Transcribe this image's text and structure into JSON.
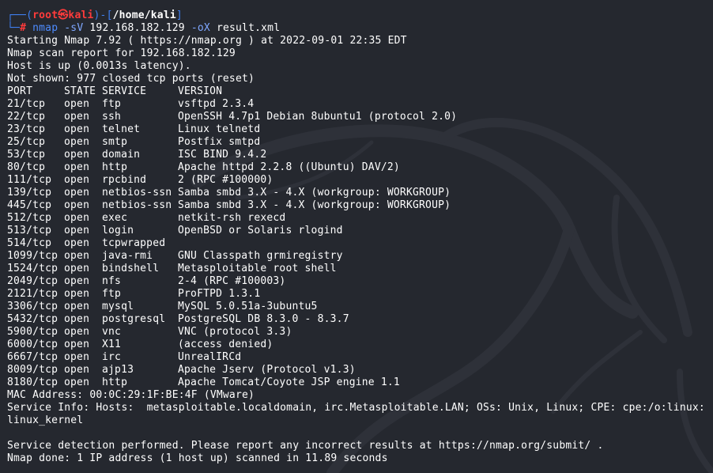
{
  "prompt": {
    "top_left": "┌──(",
    "user": "root",
    "at_symbol": "㉿",
    "host": "kali",
    "mid": ")-[",
    "path": "/home/kali",
    "close": "]",
    "bottom_left": "└─",
    "hash": "#",
    "command": "nmap",
    "flag1": "-sV",
    "target": "192.168.182.129",
    "flag2": "-oX",
    "outfile": "result.xml"
  },
  "output": {
    "start_line": "Starting Nmap 7.92 ( https://nmap.org ) at 2022-09-01 22:35 EDT",
    "report_line": "Nmap scan report for 192.168.182.129",
    "host_up": "Host is up (0.0013s latency).",
    "not_shown": "Not shown: 977 closed tcp ports (reset)",
    "headers": {
      "port": "PORT",
      "state": "STATE",
      "service": "SERVICE",
      "version": "VERSION"
    },
    "ports": [
      {
        "port": "21/tcp",
        "state": "open",
        "service": "ftp",
        "version": "vsftpd 2.3.4"
      },
      {
        "port": "22/tcp",
        "state": "open",
        "service": "ssh",
        "version": "OpenSSH 4.7p1 Debian 8ubuntu1 (protocol 2.0)"
      },
      {
        "port": "23/tcp",
        "state": "open",
        "service": "telnet",
        "version": "Linux telnetd"
      },
      {
        "port": "25/tcp",
        "state": "open",
        "service": "smtp",
        "version": "Postfix smtpd"
      },
      {
        "port": "53/tcp",
        "state": "open",
        "service": "domain",
        "version": "ISC BIND 9.4.2"
      },
      {
        "port": "80/tcp",
        "state": "open",
        "service": "http",
        "version": "Apache httpd 2.2.8 ((Ubuntu) DAV/2)"
      },
      {
        "port": "111/tcp",
        "state": "open",
        "service": "rpcbind",
        "version": "2 (RPC #100000)"
      },
      {
        "port": "139/tcp",
        "state": "open",
        "service": "netbios-ssn",
        "version": "Samba smbd 3.X - 4.X (workgroup: WORKGROUP)"
      },
      {
        "port": "445/tcp",
        "state": "open",
        "service": "netbios-ssn",
        "version": "Samba smbd 3.X - 4.X (workgroup: WORKGROUP)"
      },
      {
        "port": "512/tcp",
        "state": "open",
        "service": "exec",
        "version": "netkit-rsh rexecd"
      },
      {
        "port": "513/tcp",
        "state": "open",
        "service": "login",
        "version": "OpenBSD or Solaris rlogind"
      },
      {
        "port": "514/tcp",
        "state": "open",
        "service": "tcpwrapped",
        "version": ""
      },
      {
        "port": "1099/tcp",
        "state": "open",
        "service": "java-rmi",
        "version": "GNU Classpath grmiregistry"
      },
      {
        "port": "1524/tcp",
        "state": "open",
        "service": "bindshell",
        "version": "Metasploitable root shell"
      },
      {
        "port": "2049/tcp",
        "state": "open",
        "service": "nfs",
        "version": "2-4 (RPC #100003)"
      },
      {
        "port": "2121/tcp",
        "state": "open",
        "service": "ftp",
        "version": "ProFTPD 1.3.1"
      },
      {
        "port": "3306/tcp",
        "state": "open",
        "service": "mysql",
        "version": "MySQL 5.0.51a-3ubuntu5"
      },
      {
        "port": "5432/tcp",
        "state": "open",
        "service": "postgresql",
        "version": "PostgreSQL DB 8.3.0 - 8.3.7"
      },
      {
        "port": "5900/tcp",
        "state": "open",
        "service": "vnc",
        "version": "VNC (protocol 3.3)"
      },
      {
        "port": "6000/tcp",
        "state": "open",
        "service": "X11",
        "version": "(access denied)"
      },
      {
        "port": "6667/tcp",
        "state": "open",
        "service": "irc",
        "version": "UnrealIRCd"
      },
      {
        "port": "8009/tcp",
        "state": "open",
        "service": "ajp13",
        "version": "Apache Jserv (Protocol v1.3)"
      },
      {
        "port": "8180/tcp",
        "state": "open",
        "service": "http",
        "version": "Apache Tomcat/Coyote JSP engine 1.1"
      }
    ],
    "mac_line": "MAC Address: 00:0C:29:1F:BE:4F (VMware)",
    "service_info_1": "Service Info: Hosts:  metasploitable.localdomain, irc.Metasploitable.LAN; OSs: Unix, Linux; CPE: cpe:/o:linux:",
    "service_info_2": "linux_kernel",
    "detection_line": "Service detection performed. Please report any incorrect results at https://nmap.org/submit/ .",
    "done_line": "Nmap done: 1 IP address (1 host up) scanned in 11.89 seconds"
  },
  "colors": {
    "background": "#25282f",
    "prompt_blue": "#3f7ff0",
    "prompt_red": "#ff3b3b",
    "text": "#ffffff"
  },
  "icons": {
    "background": "kali-dragon-watermark"
  }
}
